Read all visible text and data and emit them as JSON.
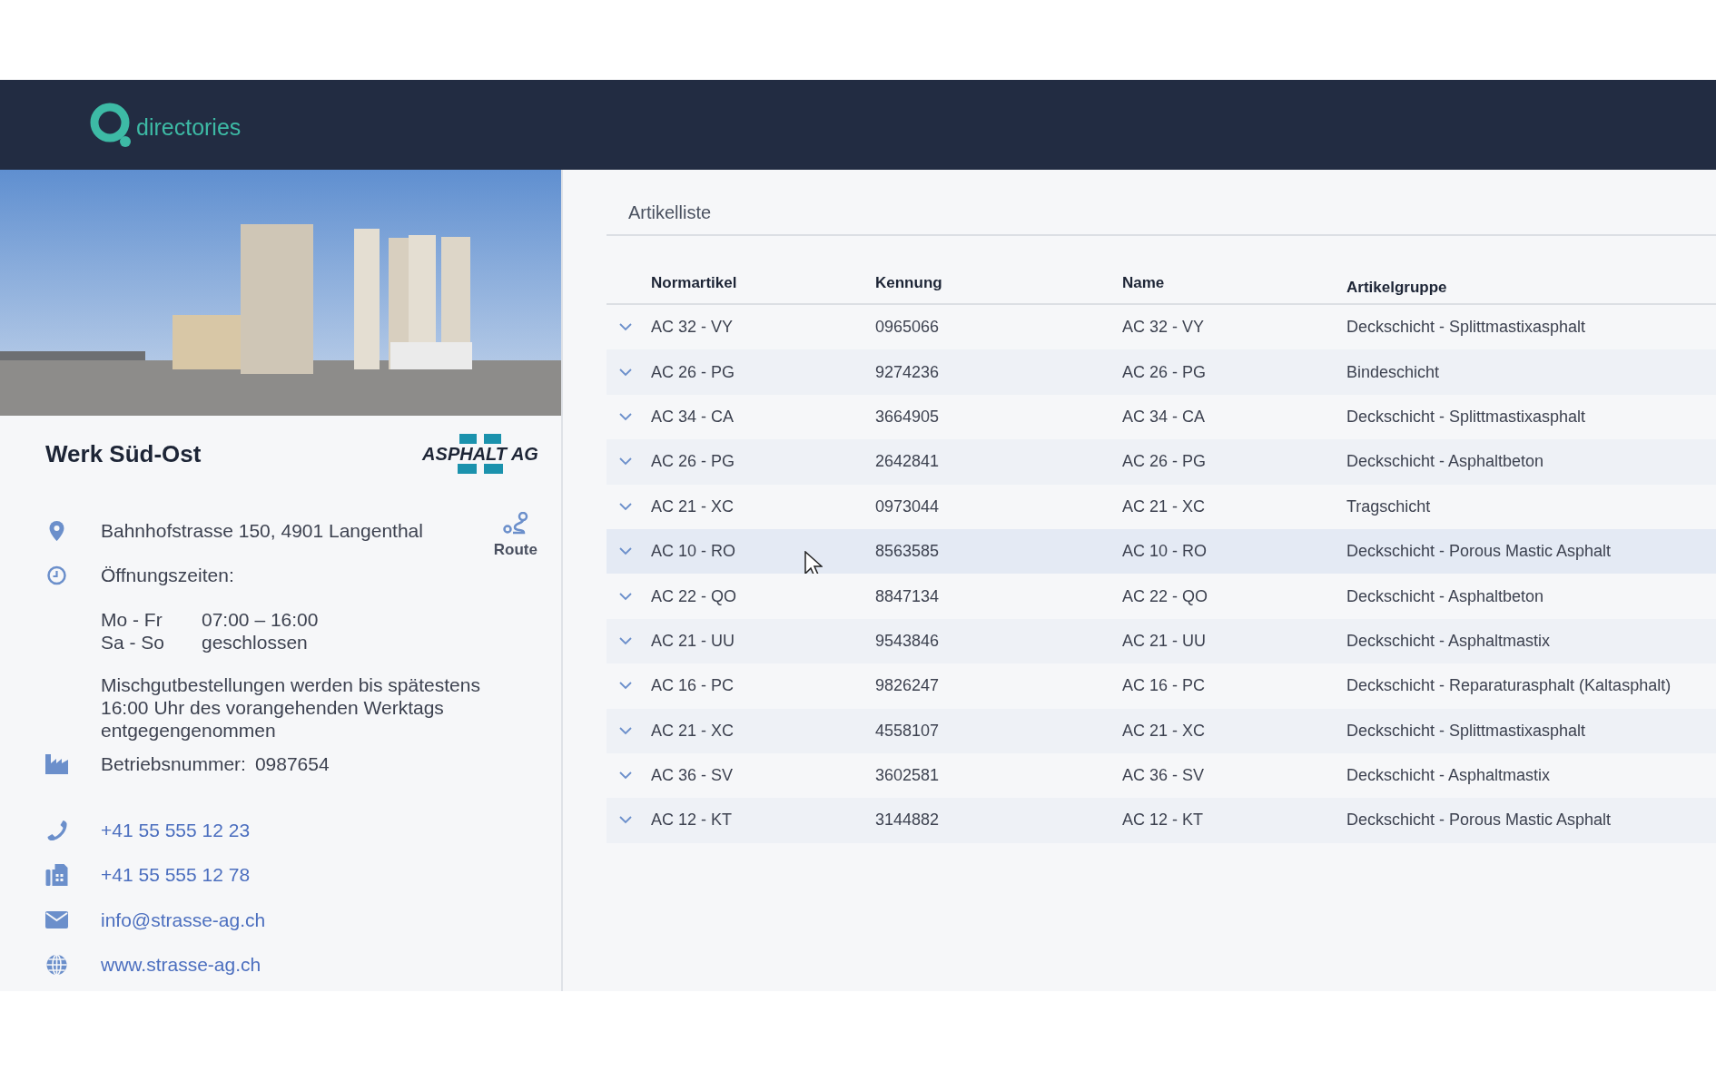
{
  "header": {
    "logo_text": "directories"
  },
  "location": {
    "title": "Werk Süd-Ost",
    "brand_logo": "ASPHALT AG",
    "address": "Bahnhofstrasse 150, 4901 Langenthal",
    "route_label": "Route",
    "hours_label": "Öffnungszeiten:",
    "hours": [
      {
        "days": "Mo - Fr",
        "time": "07:00 – 16:00"
      },
      {
        "days": "Sa - So",
        "time": "geschlossen"
      }
    ],
    "note": "Mischgutbestellungen werden bis spätestens 16:00 Uhr des vorangehenden Werktags entgegengenommen",
    "business_number_label": "Betriebsnummer:",
    "business_number": "0987654",
    "contacts": [
      {
        "kind": "phone",
        "text": "+41 55 555 12 23"
      },
      {
        "kind": "fax",
        "text": "+41 55 555 12 78"
      },
      {
        "kind": "email",
        "text": "info@strasse-ag.ch"
      },
      {
        "kind": "web",
        "text": "www.strasse-ag.ch"
      }
    ]
  },
  "articles": {
    "title": "Artikelliste",
    "columns": [
      "Normartikel",
      "Kennung",
      "Name",
      "Artikelgruppe"
    ],
    "rows": [
      {
        "cells": [
          "AC 32 - VY",
          "0965066",
          "AC 32 - VY",
          "Deckschicht - Splittmastixasphalt"
        ],
        "hovered": false
      },
      {
        "cells": [
          "AC 26 - PG",
          "9274236",
          "AC 26 - PG",
          "Bindeschicht"
        ],
        "hovered": false
      },
      {
        "cells": [
          "AC 34 - CA",
          "3664905",
          "AC 34 - CA",
          "Deckschicht - Splittmastixasphalt"
        ],
        "hovered": false
      },
      {
        "cells": [
          "AC 26 - PG",
          "2642841",
          "AC 26 - PG",
          "Deckschicht - Asphaltbeton"
        ],
        "hovered": false
      },
      {
        "cells": [
          "AC 21 - XC",
          "0973044",
          "AC 21 - XC",
          "Tragschicht"
        ],
        "hovered": false
      },
      {
        "cells": [
          "AC 10 - RO",
          "8563585",
          "AC 10 - RO",
          "Deckschicht - Porous Mastic Asphalt"
        ],
        "hovered": true
      },
      {
        "cells": [
          "AC 22 - QO",
          "8847134",
          "AC 22 - QO",
          "Deckschicht - Asphaltbeton"
        ],
        "hovered": false
      },
      {
        "cells": [
          "AC 21 - UU",
          "9543846",
          "AC 21 - UU",
          "Deckschicht - Asphaltmastix"
        ],
        "hovered": false
      },
      {
        "cells": [
          "AC 16 - PC",
          "9826247",
          "AC 16 - PC",
          "Deckschicht - Reparaturasphalt (Kaltasphalt)"
        ],
        "hovered": false
      },
      {
        "cells": [
          "AC 21 - XC",
          "4558107",
          "AC 21 - XC",
          "Deckschicht - Splittmastixasphalt"
        ],
        "hovered": false
      },
      {
        "cells": [
          "AC 36 - SV",
          "3602581",
          "AC 36 - SV",
          "Deckschicht - Asphaltmastix"
        ],
        "hovered": false
      },
      {
        "cells": [
          "AC 12 - KT",
          "3144882",
          "AC 12 - KT",
          "Deckschicht - Porous Mastic Asphalt"
        ],
        "hovered": false
      }
    ]
  }
}
